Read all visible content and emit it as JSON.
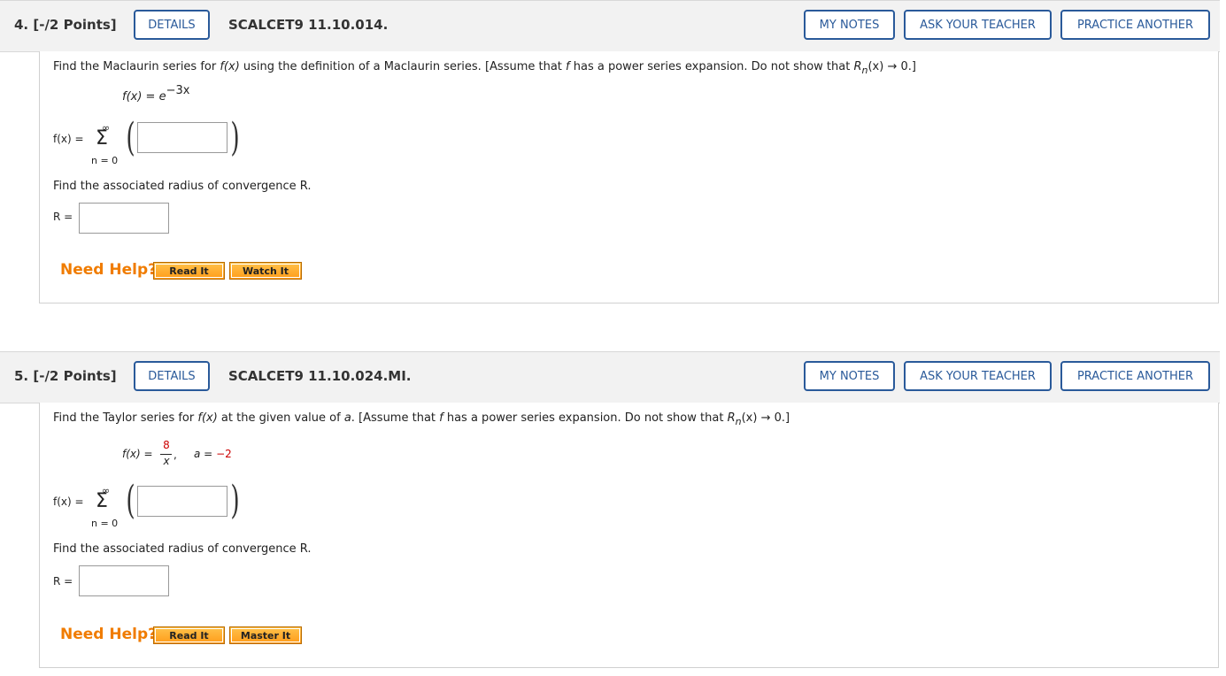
{
  "q4": {
    "number": "4.",
    "points": "[-/2 Points]",
    "details": "DETAILS",
    "id": "SCALCET9 11.10.014.",
    "my_notes": "MY NOTES",
    "ask_teacher": "ASK YOUR TEACHER",
    "practice": "PRACTICE ANOTHER",
    "prompt_a": "Find the Maclaurin series for ",
    "prompt_fx": "f(x)",
    "prompt_b": " using the definition of a Maclaurin series. [Assume that ",
    "prompt_f": "f",
    "prompt_c": " has a power series expansion. Do not show that ",
    "prompt_R": "R",
    "prompt_n": "n",
    "prompt_d": "(x) → 0.]",
    "func_lhs": "f(x) = e",
    "func_exp": "−3x",
    "sum_lhs": "f(x) =",
    "sum_top": "∞",
    "sum_sym": "Σ",
    "sum_bot": "n = 0",
    "radius_prompt": "Find the associated radius of convergence R.",
    "radius_label": "R =",
    "need_help": "Need Help?",
    "help_btn1": "Read It",
    "help_btn2": "Watch It"
  },
  "q5": {
    "number": "5.",
    "points": "[-/2 Points]",
    "details": "DETAILS",
    "id": "SCALCET9 11.10.024.MI.",
    "my_notes": "MY NOTES",
    "ask_teacher": "ASK YOUR TEACHER",
    "practice": "PRACTICE ANOTHER",
    "prompt_a": "Find the Taylor series for ",
    "prompt_fx": "f(x)",
    "prompt_b": " at the given value of ",
    "prompt_a_var": "a",
    "prompt_c": ". [Assume that ",
    "prompt_f": "f",
    "prompt_d": " has a power series expansion. Do not show that ",
    "prompt_R": "R",
    "prompt_n": "n",
    "prompt_e": "(x) → 0.]",
    "func_lhs": "f(x) =",
    "func_num": "8",
    "func_den": "x",
    "func_comma": ",",
    "a_label": "a =",
    "a_value": "−2",
    "sum_lhs": "f(x) =",
    "sum_top": "∞",
    "sum_sym": "Σ",
    "sum_bot": "n = 0",
    "radius_prompt": "Find the associated radius of convergence R.",
    "radius_label": "R =",
    "need_help": "Need Help?",
    "help_btn1": "Read It",
    "help_btn2": "Master It"
  }
}
